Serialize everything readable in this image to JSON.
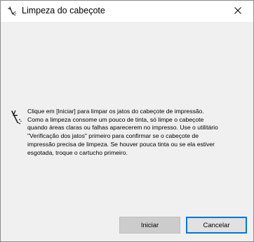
{
  "window": {
    "title": "Limpeza do cabeçote",
    "title_icon": "printer-head-icon",
    "close_icon": "close-icon"
  },
  "message": {
    "icon": "nozzle-clean-icon",
    "lines": [
      "Clique em [Iniciar] para limpar os jatos do cabeçote de impressão.",
      "Como a limpeza consome um pouco de tinta, só limpe o cabeçote",
      "quando áreas claras ou falhas aparecerem no impresso. Use o utilitário",
      "\"Verificação dos jatos\" primeiro para confirmar se o cabeçote de",
      "impressão precisa de limpeza. Se houver pouca tinta ou se ela estiver",
      "esgotada, troque o cartucho primeiro."
    ]
  },
  "buttons": {
    "start_label": "Iniciar",
    "cancel_label": "Cancelar"
  },
  "colors": {
    "focus_border": "#0078d7",
    "dialog_bg": "#f0f0f0"
  }
}
